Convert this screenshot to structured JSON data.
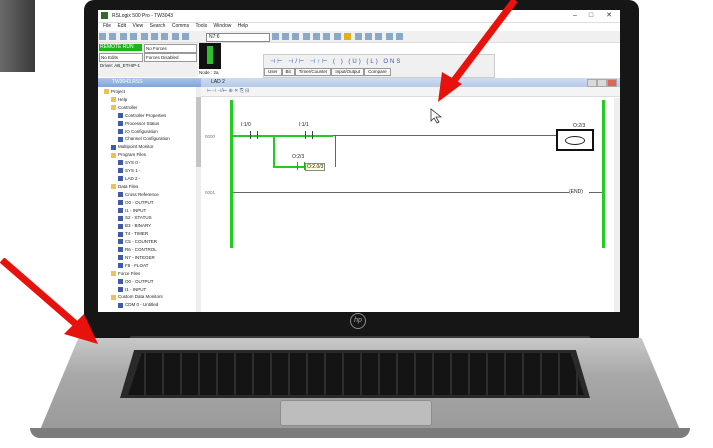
{
  "window": {
    "title": "RSLogix 500 Pro - TW3043",
    "minimize": "–",
    "maximize": "□",
    "close": "✕"
  },
  "menu": [
    "File",
    "Edit",
    "View",
    "Search",
    "Comms",
    "Tools",
    "Window",
    "Help"
  ],
  "toolbar": {
    "address_value": "N7:6"
  },
  "status_panel": {
    "mode": "REMOTE RUN",
    "forces": "No Forces",
    "edits": "No Edits",
    "forces_state": "Forces Disabled",
    "driver": "Driver: AB_ETHIP-1",
    "node": "Node : 2a"
  },
  "instruction_tabs": [
    "User",
    "Bit",
    "Timer/Counter",
    "Input/Output",
    "Compare"
  ],
  "instruction_icons": "⊣⊢ ⊣/⊢ ⊣↑⊢ ( ) (U) (L) ONS",
  "project": {
    "header": "TW3043.RSS",
    "items": [
      {
        "label": "Project",
        "level": 0,
        "icon": "folder"
      },
      {
        "label": "Help",
        "level": 1,
        "icon": "folder"
      },
      {
        "label": "Controller",
        "level": 1,
        "icon": "folder"
      },
      {
        "label": "Controller Properties",
        "level": 2,
        "icon": "doc"
      },
      {
        "label": "Processor Status",
        "level": 2,
        "icon": "doc"
      },
      {
        "label": "IO Configuration",
        "level": 2,
        "icon": "doc"
      },
      {
        "label": "Channel Configuration",
        "level": 2,
        "icon": "doc"
      },
      {
        "label": "Multipoint Monitor",
        "level": 1,
        "icon": "doc"
      },
      {
        "label": "Program Files",
        "level": 1,
        "icon": "folder"
      },
      {
        "label": "SYS 0 -",
        "level": 2,
        "icon": "doc"
      },
      {
        "label": "SYS 1 -",
        "level": 2,
        "icon": "doc"
      },
      {
        "label": "LAD 2 -",
        "level": 2,
        "icon": "doc"
      },
      {
        "label": "Data Files",
        "level": 1,
        "icon": "folder"
      },
      {
        "label": "Cross Reference",
        "level": 2,
        "icon": "doc"
      },
      {
        "label": "O0 - OUTPUT",
        "level": 2,
        "icon": "doc"
      },
      {
        "label": "I1 - INPUT",
        "level": 2,
        "icon": "doc"
      },
      {
        "label": "S2 - STATUS",
        "level": 2,
        "icon": "doc"
      },
      {
        "label": "B3 - BINARY",
        "level": 2,
        "icon": "doc"
      },
      {
        "label": "T4 - TIMER",
        "level": 2,
        "icon": "doc"
      },
      {
        "label": "C5 - COUNTER",
        "level": 2,
        "icon": "doc"
      },
      {
        "label": "R6 - CONTROL",
        "level": 2,
        "icon": "doc"
      },
      {
        "label": "N7 - INTEGER",
        "level": 2,
        "icon": "doc"
      },
      {
        "label": "F8 - FLOAT",
        "level": 2,
        "icon": "doc"
      },
      {
        "label": "Force Files",
        "level": 1,
        "icon": "folder"
      },
      {
        "label": "O0 - OUTPUT",
        "level": 2,
        "icon": "doc"
      },
      {
        "label": "I1 - INPUT",
        "level": 2,
        "icon": "doc"
      },
      {
        "label": "Custom Data Monitors",
        "level": 1,
        "icon": "folder"
      },
      {
        "label": "CDM 0 - Untitled",
        "level": 2,
        "icon": "doc"
      }
    ]
  },
  "ladder": {
    "title": "LAD 2",
    "rungs": [
      {
        "number": "0000"
      },
      {
        "number": "0001"
      }
    ],
    "contact1": "I:1/0",
    "contact2": "I:1/1",
    "branch_contact": "O:2/3",
    "branch_tag": "O:2.0/3",
    "coil": "O:2/3",
    "end": "END"
  },
  "laptop": {
    "logo": "hp"
  },
  "colors": {
    "rail": "#22cc22",
    "arrow": "#e8120c",
    "run_status": "#1db31d"
  }
}
